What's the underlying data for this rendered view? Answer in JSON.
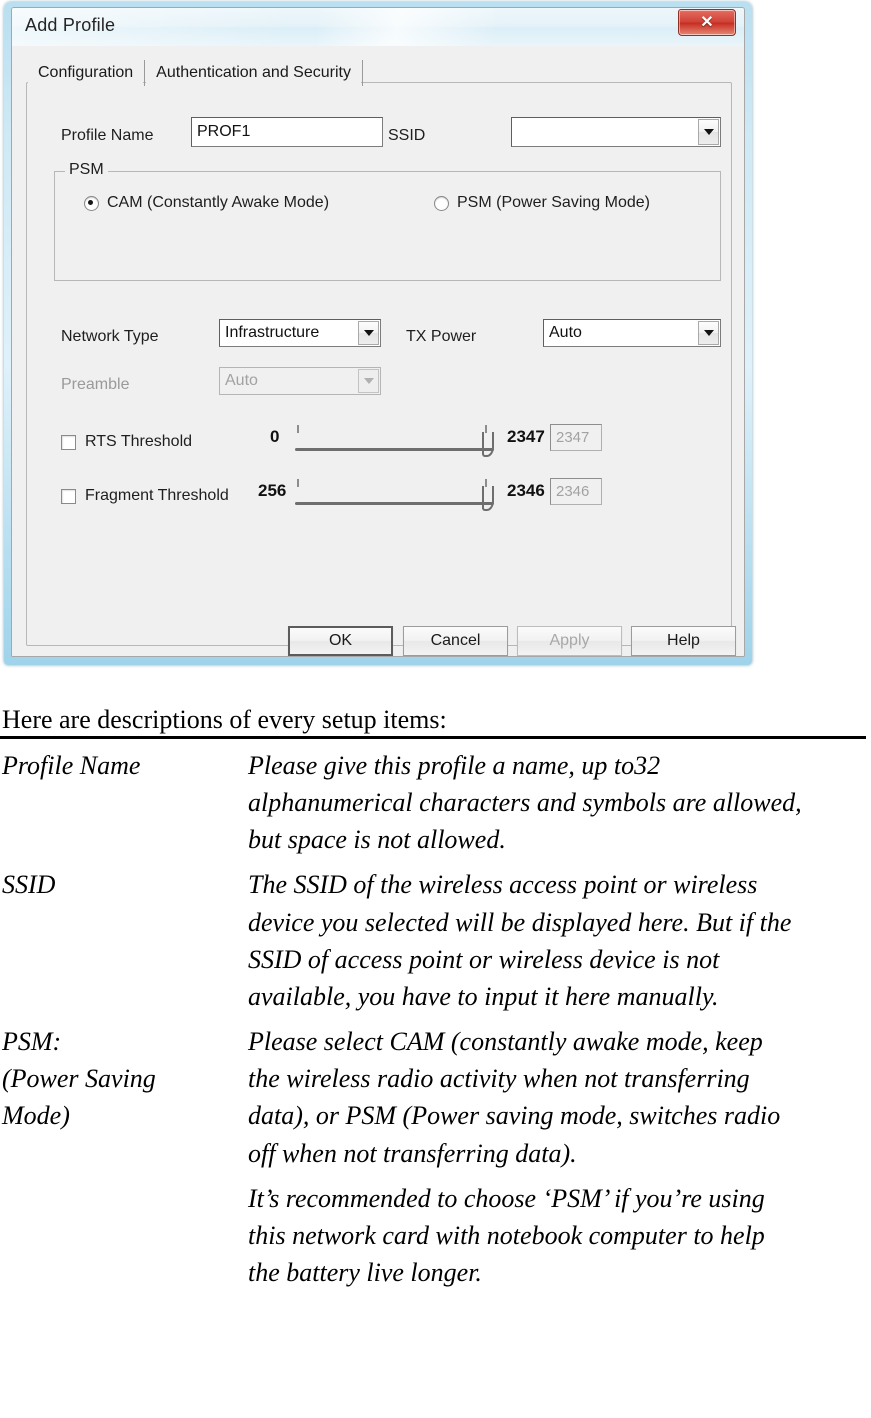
{
  "window": {
    "title": "Add Profile",
    "close_label": "✕"
  },
  "tabs": [
    {
      "label": "Configuration",
      "selected": true
    },
    {
      "label": "Authentication and Security",
      "selected": false
    }
  ],
  "form": {
    "profile_name_label": "Profile Name",
    "profile_name_value": "PROF1",
    "ssid_label": "SSID",
    "ssid_value": "",
    "psm_group_label": "PSM",
    "psm_cam_label": "CAM (Constantly Awake Mode)",
    "psm_psm_label": "PSM (Power Saving Mode)",
    "network_type_label": "Network Type",
    "network_type_value": "Infrastructure",
    "tx_power_label": "TX Power",
    "tx_power_value": "Auto",
    "preamble_label": "Preamble",
    "preamble_value": "Auto",
    "rts_label": "RTS Threshold",
    "rts_min": "0",
    "rts_max": "2347",
    "rts_value": "2347",
    "frag_label": "Fragment Threshold",
    "frag_min": "256",
    "frag_max": "2346",
    "frag_value": "2346"
  },
  "buttons": {
    "ok": "OK",
    "cancel": "Cancel",
    "apply": "Apply",
    "help": "Help"
  },
  "document": {
    "heading": "Here are descriptions of every setup items:",
    "entries": [
      {
        "term": [
          "Profile Name"
        ],
        "desc": [
          "Please give this profile a name, up to32",
          "alphanumerical characters and symbols are allowed,",
          "but space is not allowed."
        ]
      },
      {
        "term": [
          "SSID"
        ],
        "desc": [
          "The SSID of the wireless access point or wireless",
          "device you selected will be displayed here. But if the",
          "SSID of access point or wireless device is not",
          "available, you have to input it here manually."
        ]
      },
      {
        "term": [
          "PSM:",
          "(Power Saving",
          "Mode)"
        ],
        "desc": [
          "Please select CAM (constantly awake mode, keep",
          "the wireless radio activity when not transferring",
          "data), or PSM (Power saving mode, switches radio",
          "off when not transferring data)."
        ]
      },
      {
        "term": [],
        "desc": [
          "It’s recommended to choose ‘PSM’ if you’re using",
          "this network card with notebook computer to help",
          "the battery live longer."
        ]
      }
    ]
  }
}
